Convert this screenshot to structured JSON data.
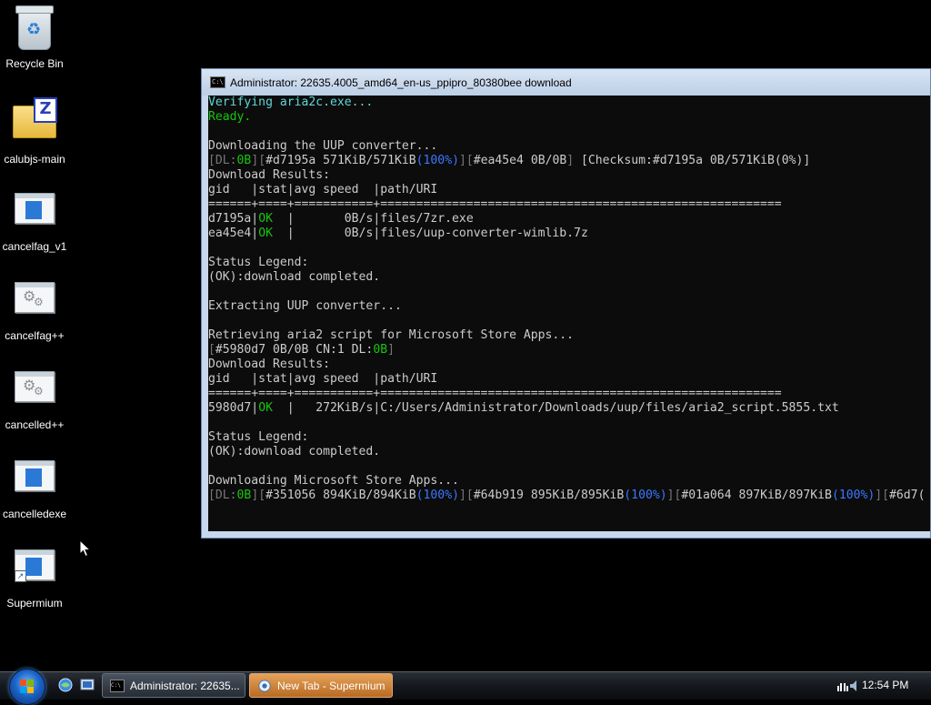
{
  "desktop": {
    "icons": [
      {
        "label": "Recycle Bin",
        "icon": "recycle-bin-icon"
      },
      {
        "label": "calubjs-main",
        "icon": "zip-folder-icon"
      },
      {
        "label": "cancelfag_v1",
        "icon": "application-window-icon"
      },
      {
        "label": "cancelfag++",
        "icon": "gears-file-icon"
      },
      {
        "label": "cancelled++",
        "icon": "gears-file-icon"
      },
      {
        "label": "cancelledexe",
        "icon": "application-window-icon"
      },
      {
        "label": "Supermium",
        "icon": "application-window-shortcut-icon"
      }
    ]
  },
  "console": {
    "title": "Administrator:  22635.4005_amd64_en-us_ppipro_80380bee download",
    "icon": "command-prompt-icon",
    "colors": {
      "background": "#0c0c0c",
      "text": "#cccccc",
      "cyan": "#61d6d6",
      "green": "#16c60c",
      "blue": "#3b78ff",
      "gray": "#767676"
    },
    "lines": [
      [
        {
          "t": "Verifying aria2c.exe...",
          "c": "cyan"
        }
      ],
      [
        {
          "t": "Ready.",
          "c": "green"
        }
      ],
      [
        {
          "t": ""
        }
      ],
      [
        {
          "t": "Downloading the UUP converter..."
        }
      ],
      [
        {
          "t": "[",
          "c": "gray"
        },
        {
          "t": "DL:",
          "c": "gray"
        },
        {
          "t": "0B",
          "c": "green"
        },
        {
          "t": "][",
          "c": "gray"
        },
        {
          "t": "#d7195a 571KiB/571KiB"
        },
        {
          "t": "(100%)",
          "c": "blue"
        },
        {
          "t": "][",
          "c": "gray"
        },
        {
          "t": "#ea45e4 0B/0B"
        },
        {
          "t": "] ",
          "c": "gray"
        },
        {
          "t": "[Checksum:#d7195a 0B/571KiB(0%)]"
        }
      ],
      [
        {
          "t": "Download Results:"
        }
      ],
      [
        {
          "t": "gid   |stat|avg speed  |path/URI"
        }
      ],
      [
        {
          "t": "======+====+===========+========================================================"
        }
      ],
      [
        {
          "t": "d7195a|"
        },
        {
          "t": "OK",
          "c": "green"
        },
        {
          "t": "  |       0B/s|files/7zr.exe"
        }
      ],
      [
        {
          "t": "ea45e4|"
        },
        {
          "t": "OK",
          "c": "green"
        },
        {
          "t": "  |       0B/s|files/uup-converter-wimlib.7z"
        }
      ],
      [
        {
          "t": ""
        }
      ],
      [
        {
          "t": "Status Legend:"
        }
      ],
      [
        {
          "t": "(OK):download completed."
        }
      ],
      [
        {
          "t": ""
        }
      ],
      [
        {
          "t": "Extracting UUP converter..."
        }
      ],
      [
        {
          "t": ""
        }
      ],
      [
        {
          "t": "Retrieving aria2 script for Microsoft Store Apps..."
        }
      ],
      [
        {
          "t": "[",
          "c": "gray"
        },
        {
          "t": "#5980d7 0B/0B CN:1 DL:"
        },
        {
          "t": "0B",
          "c": "green"
        },
        {
          "t": "]",
          "c": "gray"
        }
      ],
      [
        {
          "t": "Download Results:"
        }
      ],
      [
        {
          "t": "gid   |stat|avg speed  |path/URI"
        }
      ],
      [
        {
          "t": "======+====+===========+========================================================"
        }
      ],
      [
        {
          "t": "5980d7|"
        },
        {
          "t": "OK",
          "c": "green"
        },
        {
          "t": "  |   272KiB/s|C:/Users/Administrator/Downloads/uup/files/aria2_script.5855.txt"
        }
      ],
      [
        {
          "t": ""
        }
      ],
      [
        {
          "t": "Status Legend:"
        }
      ],
      [
        {
          "t": "(OK):download completed."
        }
      ],
      [
        {
          "t": ""
        }
      ],
      [
        {
          "t": "Downloading Microsoft Store Apps..."
        }
      ],
      [
        {
          "t": "[",
          "c": "gray"
        },
        {
          "t": "DL:",
          "c": "gray"
        },
        {
          "t": "0B",
          "c": "green"
        },
        {
          "t": "][",
          "c": "gray"
        },
        {
          "t": "#351056 894KiB/894KiB"
        },
        {
          "t": "(100%)",
          "c": "blue"
        },
        {
          "t": "][",
          "c": "gray"
        },
        {
          "t": "#64b919 895KiB/895KiB"
        },
        {
          "t": "(100%)",
          "c": "blue"
        },
        {
          "t": "][",
          "c": "gray"
        },
        {
          "t": "#01a064 897KiB/897KiB"
        },
        {
          "t": "(100%)",
          "c": "blue"
        },
        {
          "t": "][",
          "c": "gray"
        },
        {
          "t": "#6d7("
        }
      ]
    ]
  },
  "taskbar": {
    "start_icon": "windows-start-orb-icon",
    "quick_launch": [
      "browser-icon",
      "show-desktop-icon"
    ],
    "buttons": [
      {
        "label": "Administrator:  22635...",
        "icon": "command-prompt-icon",
        "active": false
      },
      {
        "label": "New Tab - Supermium",
        "icon": "supermium-browser-icon",
        "active": true
      }
    ],
    "tray_icons": [
      "network-icon",
      "volume-icon"
    ],
    "clock": "12:54 PM"
  }
}
